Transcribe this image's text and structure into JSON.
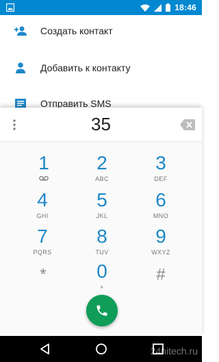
{
  "status_bar": {
    "time": "18:46",
    "icons": [
      "photo-icon",
      "wifi-icon",
      "signal-icon",
      "battery-icon"
    ]
  },
  "menu": {
    "items": [
      {
        "label": "Создать контакт",
        "icon": "add-person-icon"
      },
      {
        "label": "Добавить к контакту",
        "icon": "person-icon"
      },
      {
        "label": "Отправить SMS",
        "icon": "message-icon"
      }
    ]
  },
  "dialer": {
    "entered_digits": "35",
    "keys": [
      {
        "digit": "1",
        "letters": ""
      },
      {
        "digit": "2",
        "letters": "ABC"
      },
      {
        "digit": "3",
        "letters": "DEF"
      },
      {
        "digit": "4",
        "letters": "GHI"
      },
      {
        "digit": "5",
        "letters": "JKL"
      },
      {
        "digit": "6",
        "letters": "MNO"
      },
      {
        "digit": "7",
        "letters": "PQRS"
      },
      {
        "digit": "8",
        "letters": "TUV"
      },
      {
        "digit": "9",
        "letters": "WXYZ"
      },
      {
        "digit": "*",
        "letters": ""
      },
      {
        "digit": "0",
        "letters": "+"
      },
      {
        "digit": "#",
        "letters": ""
      }
    ]
  },
  "watermark": "24hitech.ru",
  "colors": {
    "status_bar": "#0288d1",
    "accent": "#1e88c8",
    "call_button": "#0f9d58"
  }
}
